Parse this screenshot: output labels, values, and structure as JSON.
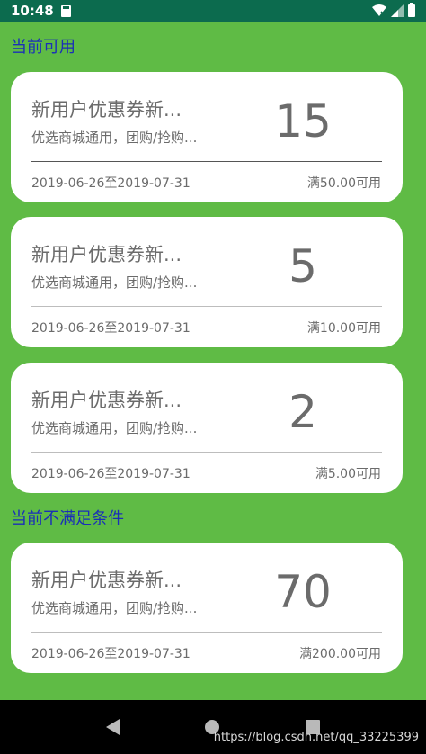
{
  "status_bar": {
    "time": "10:48"
  },
  "sections": {
    "available_title": "当前可用",
    "unavailable_title": "当前不满足条件"
  },
  "coupons": [
    {
      "name": "新用户优惠券新...",
      "desc": "优选商城通用，团购/抢购...",
      "amount": "15",
      "date": "2019-06-26至2019-07-31",
      "condition": "满50.00可用"
    },
    {
      "name": "新用户优惠券新...",
      "desc": "优选商城通用，团购/抢购...",
      "amount": "5",
      "date": "2019-06-26至2019-07-31",
      "condition": "满10.00可用"
    },
    {
      "name": "新用户优惠券新...",
      "desc": "优选商城通用，团购/抢购...",
      "amount": "2",
      "date": "2019-06-26至2019-07-31",
      "condition": "满5.00可用"
    },
    {
      "name": "新用户优惠券新...",
      "desc": "优选商城通用，团购/抢购...",
      "amount": "70",
      "date": "2019-06-26至2019-07-31",
      "condition": "满200.00可用"
    }
  ],
  "watermark": "https://blog.csdn.net/qq_33225399",
  "colors": {
    "background": "#5fbb45",
    "status_bar": "#0c6b4e",
    "section_title": "#1a2fb8",
    "card": "#ffffff",
    "text": "#6b6b6b"
  }
}
